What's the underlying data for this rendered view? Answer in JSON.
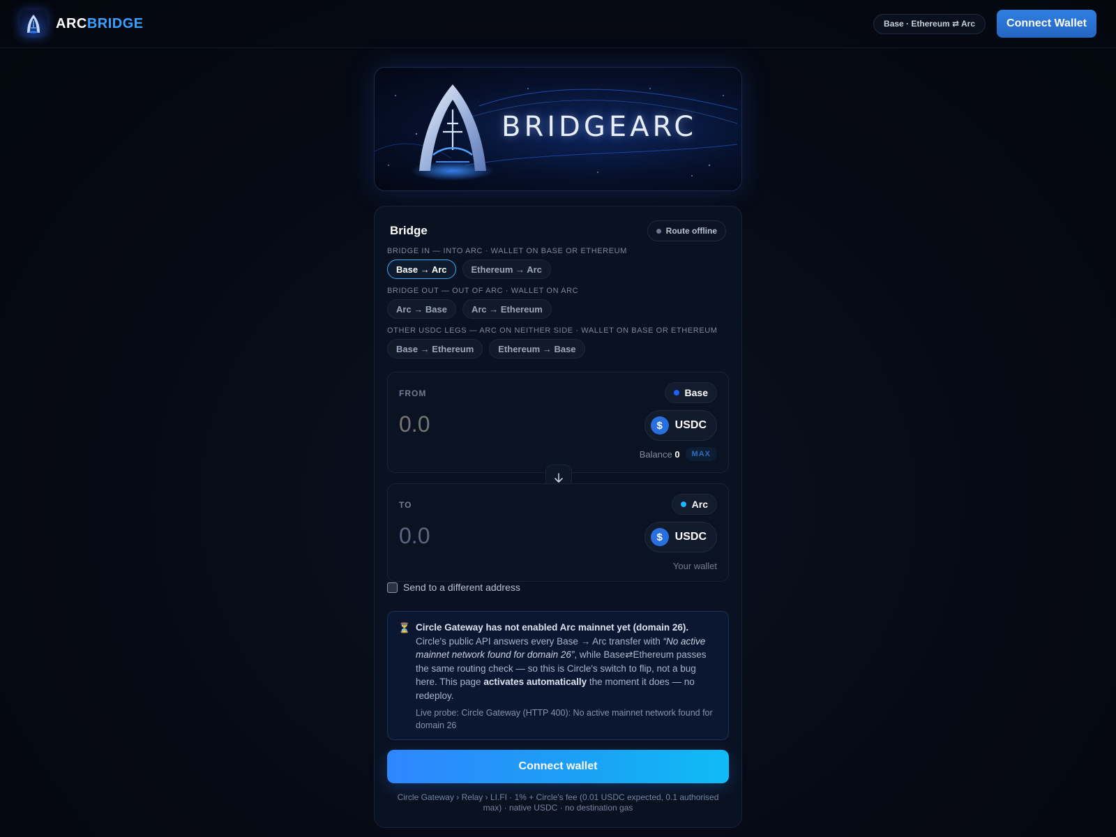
{
  "header": {
    "brand_part1": "ARC",
    "brand_part2": "BRIDGE",
    "route_label": "Base · Ethereum ⇄ Arc",
    "connect_label": "Connect Wallet"
  },
  "banner": {
    "title": "BRIDGEARC"
  },
  "bridge": {
    "title": "Bridge",
    "status": "Route offline",
    "groups": [
      {
        "label": "BRIDGE IN — INTO ARC · WALLET ON BASE OR ETHEREUM",
        "routes": [
          "Base → Arc",
          "Ethereum → Arc"
        ],
        "active_route": "Base → Arc"
      },
      {
        "label": "BRIDGE OUT — OUT OF ARC · WALLET ON ARC",
        "routes": [
          "Arc → Base",
          "Arc → Ethereum"
        ]
      },
      {
        "label": "OTHER USDC LEGS — ARC ON NEITHER SIDE · WALLET ON BASE OR ETHEREUM",
        "routes": [
          "Base → Ethereum",
          "Ethereum → Base"
        ]
      }
    ],
    "from": {
      "label": "FROM",
      "network": "Base",
      "network_color": "#1e62ff",
      "amount_placeholder": "0.0",
      "token": "USDC",
      "token_symbol": "$",
      "balance_label": "Balance",
      "balance_value": "0",
      "max_label": "MAX"
    },
    "to": {
      "label": "TO",
      "network": "Arc",
      "network_color": "#18b8ff",
      "amount_placeholder": "0.0",
      "token": "USDC",
      "token_symbol": "$",
      "wallet_hint": "Your wallet"
    },
    "different_address_label": "Send to a different address",
    "notice": {
      "icon": "⏳",
      "title": "Circle Gateway has not enabled Arc mainnet yet (domain 26).",
      "body_1": "Circle's public API answers every Base → Arc transfer with ",
      "body_quote": "“No active mainnet network found for domain 26”",
      "body_2": ", while Base⇄Ethereum passes the same routing check — so this is Circle's switch to flip, not a bug here. This page ",
      "body_strong": "activates automatically",
      "body_3": " the moment it does — no redeploy.",
      "probe": "Live probe: Circle Gateway (HTTP 400): No active mainnet network found for domain 26"
    },
    "cta_label": "Connect wallet",
    "footnote": "Circle Gateway › Relay › LI.FI · 1% + Circle's fee (0.01 USDC expected, 0.1 authorised max) · native USDC · no destination gas"
  },
  "colors": {
    "accent": "#2f86ff",
    "accent_cyan": "#0fbcf5",
    "background": "#060a14"
  }
}
